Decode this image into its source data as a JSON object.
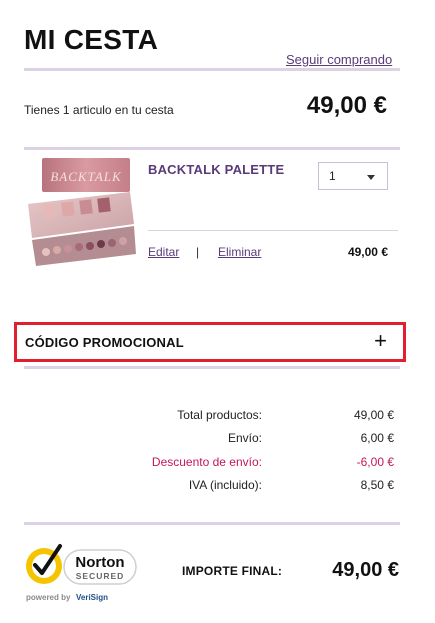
{
  "header": {
    "title": "MI CESTA",
    "continue_link": "Seguir comprando"
  },
  "cart": {
    "count_text": "Tienes 1 articulo en tu cesta",
    "total": "49,00 €"
  },
  "item": {
    "name": "BACKTALK PALETTE",
    "image_label": "BACKTALK",
    "quantity": "1",
    "edit_label": "Editar",
    "separator": "|",
    "remove_label": "Eliminar",
    "price": "49,00 €"
  },
  "promo": {
    "label": "CÓDIGO PROMOCIONAL",
    "toggle": "+"
  },
  "summary": [
    {
      "label": "Total productos:",
      "value": "49,00 €",
      "type": "normal"
    },
    {
      "label": "Envío:",
      "value": "6,00 €",
      "type": "normal"
    },
    {
      "label": "Descuento de envío:",
      "value": "-6,00 €",
      "type": "discount"
    },
    {
      "label": "IVA (incluido):",
      "value": "8,50 €",
      "type": "normal"
    }
  ],
  "badge": {
    "brand": "Norton",
    "secured": "SECURED",
    "powered": "powered by",
    "verisign": "VeriSign"
  },
  "final": {
    "label": "IMPORTE FINAL:",
    "value": "49,00 €"
  },
  "colors": {
    "accent_purple": "#5b3a7a",
    "divider": "#ddd1e4",
    "promo_border": "#e0202e",
    "discount": "#c2185b",
    "norton_yellow": "#f5c400"
  }
}
